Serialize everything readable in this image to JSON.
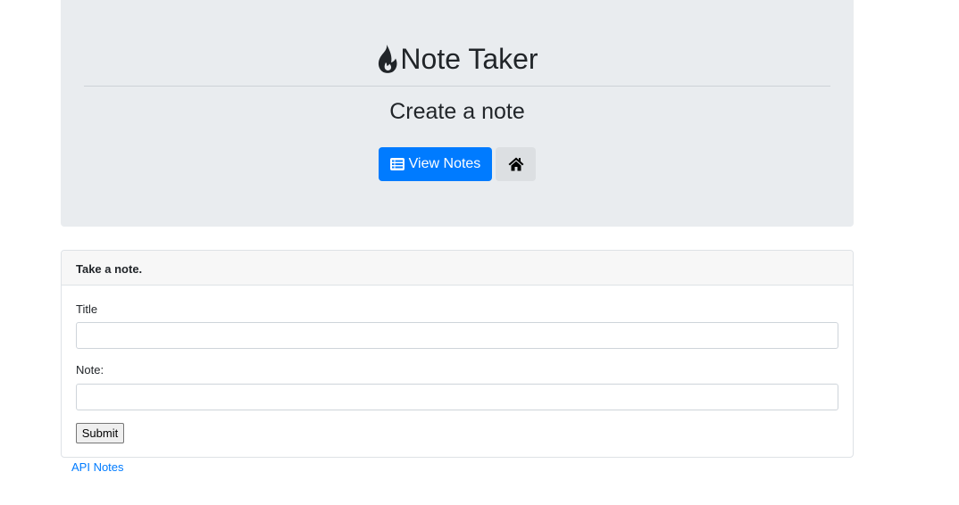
{
  "header": {
    "brand_title": "Note Taker",
    "subtitle": "Create a note",
    "view_notes_label": "View Notes",
    "icons": {
      "brand": "fire-icon",
      "view_notes": "list-icon",
      "home": "home-icon"
    }
  },
  "form": {
    "card_title": "Take a note.",
    "title_label": "Title",
    "title_value": "",
    "note_label": "Note:",
    "note_value": "",
    "submit_label": "Submit"
  },
  "footer": {
    "api_link_label": "API Notes"
  },
  "colors": {
    "primary": "#007bff",
    "jumbotron": "#e9ecef",
    "text": "#212529"
  }
}
